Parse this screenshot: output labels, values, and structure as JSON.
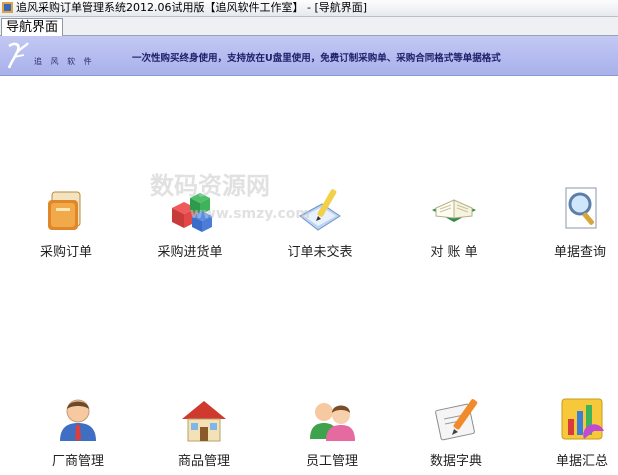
{
  "window": {
    "title": "追风采购订单管理系统2012.06试用版【追风软件工作室】 - [导航界面]"
  },
  "tabs": [
    {
      "label": "导航界面"
    }
  ],
  "banner": {
    "brand": "追 风 软 件",
    "slogan": "一次性购买终身使用，支持放在U盘里使用，免费订制采购单、采购合同格式等单据格式"
  },
  "watermark": {
    "text": "数码资源网",
    "url": "www.smzy.com"
  },
  "nav_items": [
    {
      "label": "采购订单",
      "icon": "folder-icon"
    },
    {
      "label": "采购进货单",
      "icon": "boxes-icon"
    },
    {
      "label": "订单未交表",
      "icon": "document-pen-icon"
    },
    {
      "label": "对 账 单",
      "icon": "open-book-icon"
    },
    {
      "label": "单据查询",
      "icon": "magnifier-icon"
    },
    {
      "label": "厂商管理",
      "icon": "person-icon"
    },
    {
      "label": "商品管理",
      "icon": "house-icon"
    },
    {
      "label": "员工管理",
      "icon": "people-icon"
    },
    {
      "label": "数据字典",
      "icon": "dictionary-icon"
    },
    {
      "label": "单据汇总",
      "icon": "chart-icon"
    }
  ]
}
